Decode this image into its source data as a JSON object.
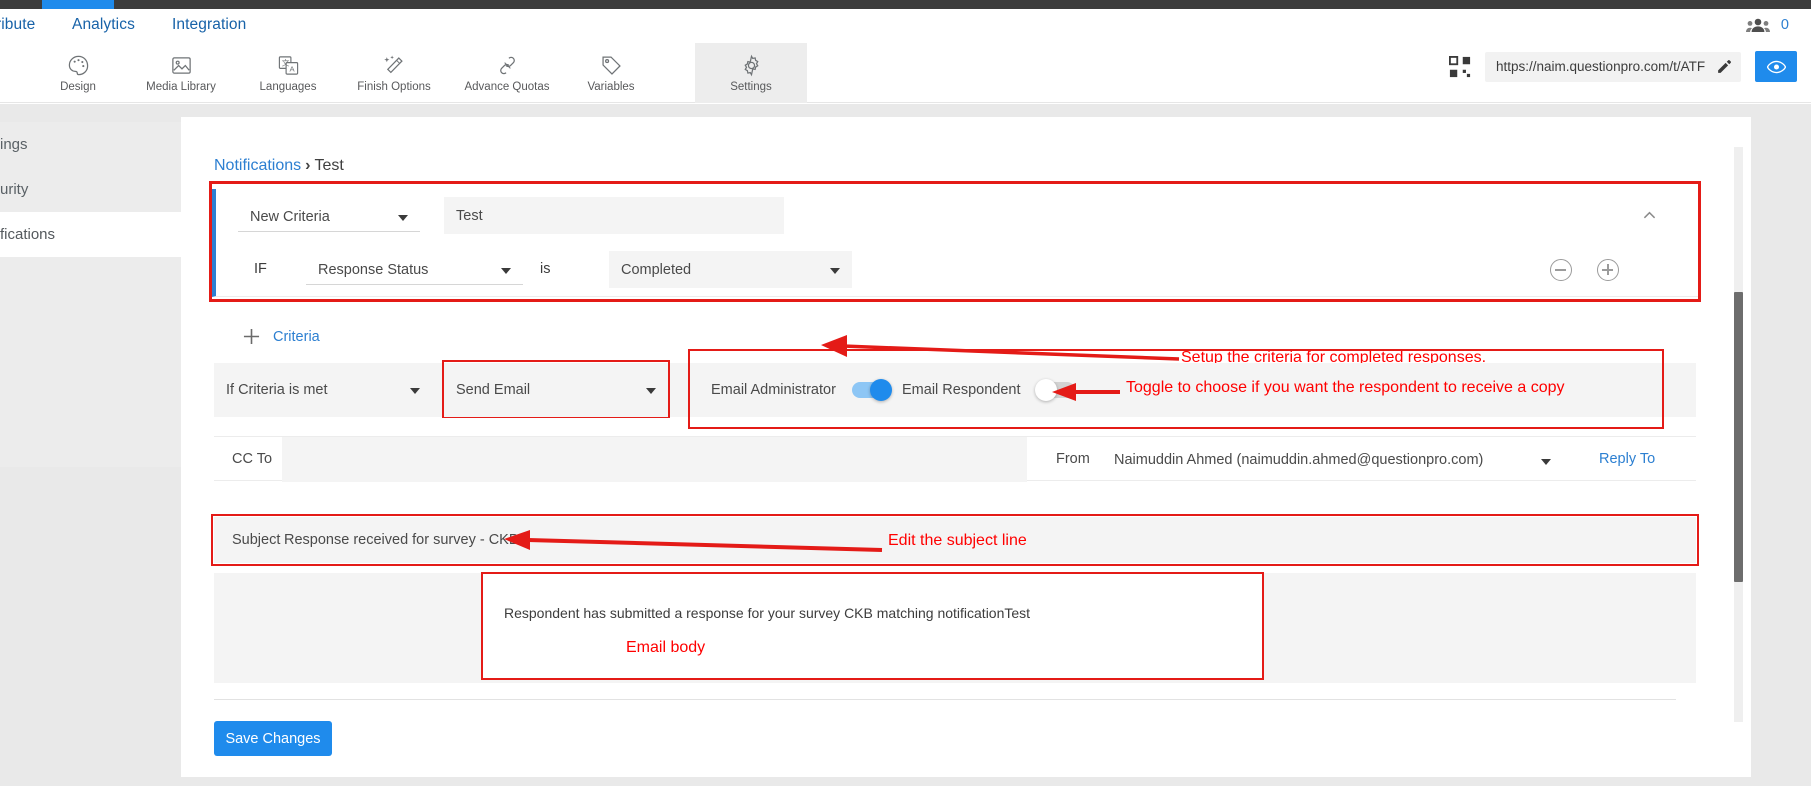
{
  "colors": {
    "accent": "#1f8bec",
    "link": "#2c7fd1",
    "annotation": "#ff0000",
    "dark": "#3c3c3c"
  },
  "menubar": {
    "items": [
      {
        "label": "ribute",
        "truncated": true
      },
      {
        "label": "Analytics"
      },
      {
        "label": "Integration"
      }
    ],
    "people_icon": "people-icon",
    "people_count": "0"
  },
  "toolbar": {
    "tools": [
      {
        "label": "Design",
        "icon": "palette-icon",
        "selected": false
      },
      {
        "label": "Media Library",
        "icon": "image-icon",
        "selected": false
      },
      {
        "label": "Languages",
        "icon": "translate-icon",
        "selected": false
      },
      {
        "label": "Finish Options",
        "icon": "magic-wand-icon",
        "selected": false
      },
      {
        "label": "Advance Quotas",
        "icon": "link-chain-icon",
        "selected": false
      },
      {
        "label": "Variables",
        "icon": "tag-icon",
        "selected": false
      },
      {
        "label": "Settings",
        "icon": "gear-icon",
        "selected": true
      }
    ],
    "qr_icon": "qr-code-icon",
    "survey_url": "https://naim.questionpro.com/t/ATF",
    "edit_icon": "pencil-icon",
    "preview_icon": "eye-icon"
  },
  "sidebar": {
    "items": [
      {
        "label": "ings",
        "active": false
      },
      {
        "label": "urity",
        "active": false
      },
      {
        "label": "fications",
        "active": true
      }
    ]
  },
  "breadcrumb": {
    "root": "Notifications",
    "separator": "›",
    "current": "Test"
  },
  "criteria": {
    "type_select": "New Criteria",
    "name_value": "Test",
    "if_label": "IF",
    "field_select": "Response Status",
    "operator_label": "is",
    "value_select": "Completed",
    "remove_icon": "minus-circle-icon",
    "add_icon": "plus-circle-icon",
    "collapse_icon": "chevron-up-icon",
    "add_criteria_label": "Criteria",
    "add_criteria_icon": "plus-icon"
  },
  "action": {
    "condition_select": "If Criteria is met",
    "action_select": "Send Email",
    "email_admin_label": "Email Administrator",
    "email_admin_on": true,
    "email_respondent_label": "Email Respondent",
    "email_respondent_on": false
  },
  "mail": {
    "cc_label": "CC To",
    "cc_value": "",
    "from_label": "From",
    "from_value": "Naimuddin Ahmed (naimuddin.ahmed@questionpro.com)",
    "reply_to_label": "Reply To",
    "subject_label": "Subject",
    "subject_value": "Response received for survey - CKB",
    "body_value": "Respondent has submitted a response for your survey CKB matching notificationTest"
  },
  "footer": {
    "save_label": "Save Changes"
  },
  "annotations": [
    {
      "id": "criteria-note",
      "text": "Setup the criteria for completed responses."
    },
    {
      "id": "toggle-note",
      "text": "Toggle to choose if you want the respondent to receive a copy"
    },
    {
      "id": "subject-note",
      "text": "Edit the subject line"
    },
    {
      "id": "email-body-note",
      "text": "Email body"
    }
  ]
}
